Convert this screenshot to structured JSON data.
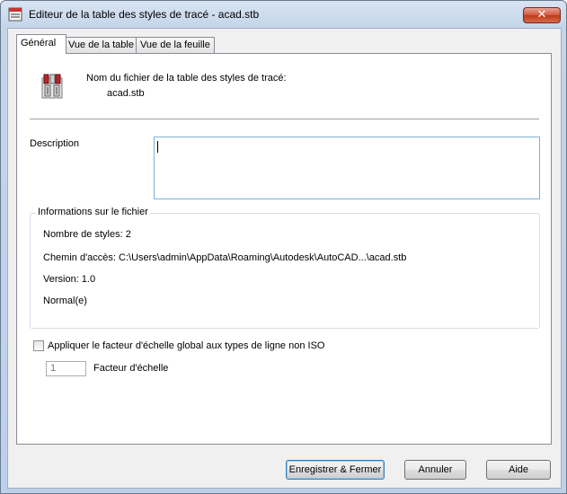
{
  "window": {
    "title": "Editeur de la table des styles de tracé - acad.stb",
    "close_label": "✕"
  },
  "tabs": [
    {
      "label": "Général",
      "active": true
    },
    {
      "label": "Vue de la table",
      "active": false
    },
    {
      "label": "Vue de la feuille",
      "active": false
    }
  ],
  "general": {
    "filename_caption": "Nom du fichier de la table des styles de tracé:",
    "filename": "acad.stb",
    "description_label": "Description",
    "description_value": "",
    "file_info": {
      "title": "Informations sur le fichier",
      "styles_count": "Nombre de styles: 2",
      "path": "Chemin d'accès: C:\\Users\\admin\\AppData\\Roaming\\Autodesk\\AutoCAD...\\acad.stb",
      "version": "Version: 1.0",
      "normal": "Normal(e)"
    },
    "apply_scale_label": "Appliquer le facteur d'échelle global aux types de ligne non ISO",
    "apply_scale_checked": false,
    "scale_value": "1",
    "scale_label": "Facteur d'échelle"
  },
  "buttons": {
    "save_close": "Enregistrer & Fermer",
    "cancel": "Annuler",
    "help": "Aide"
  }
}
